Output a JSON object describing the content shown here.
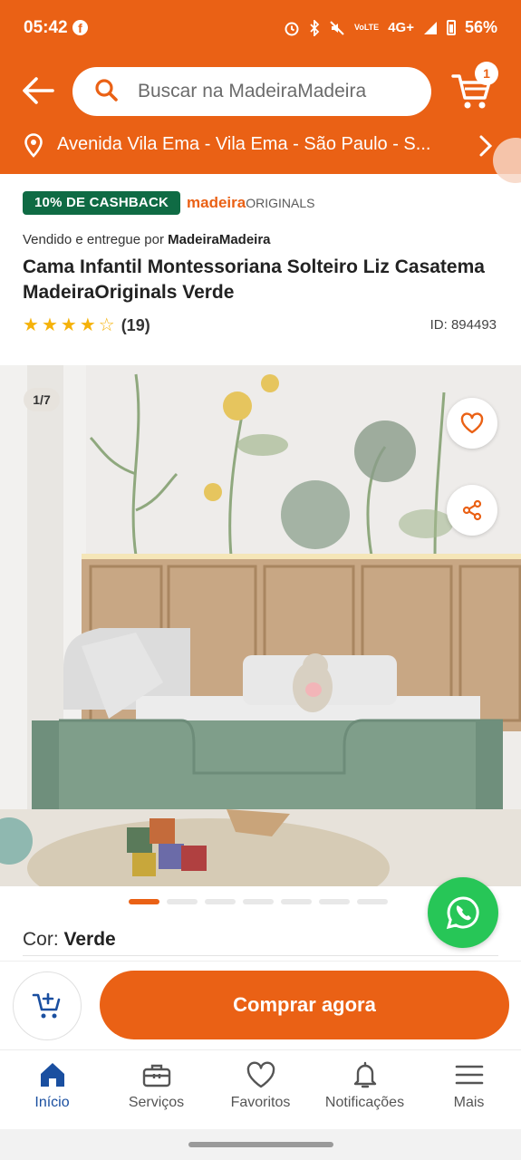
{
  "statusbar": {
    "time": "05:42",
    "app_badge": "f",
    "network_small": "VoLTE",
    "network": "4G+",
    "battery": "56%"
  },
  "header": {
    "search_placeholder": "Buscar na MadeiraMadeira",
    "cart_count": "1",
    "address": "Avenida Vila Ema - Vila Ema - São Paulo - S..."
  },
  "product": {
    "cashback": "10% DE CASHBACK",
    "brand_part1": "madeira",
    "brand_part2": "ORIGINALS",
    "seller_prefix": "Vendido e entregue por",
    "seller_name": "MadeiraMadeira",
    "title": "Cama Infantil Montessoriana Solteiro Liz Casatema MadeiraOriginals Verde",
    "rating": 4,
    "rating_max": 5,
    "rating_count": "(19)",
    "id": "ID: 894493",
    "image_counter": "1/7",
    "image_index": 1,
    "image_total": 7,
    "color_label": "Cor:",
    "color_value": "Verde"
  },
  "actions": {
    "buy_now": "Comprar agora"
  },
  "nav": {
    "items": [
      {
        "label": "Início",
        "icon": "home-icon",
        "active": true
      },
      {
        "label": "Serviços",
        "icon": "toolbox-icon",
        "active": false
      },
      {
        "label": "Favoritos",
        "icon": "heart-icon",
        "active": false
      },
      {
        "label": "Notificações",
        "icon": "bell-icon",
        "active": false
      },
      {
        "label": "Mais",
        "icon": "menu-icon",
        "active": false
      }
    ]
  },
  "colors": {
    "brand_orange": "#ea6115",
    "cashback_green": "#0f6b44",
    "nav_active_blue": "#1a4fa0",
    "whatsapp_green": "#27c657",
    "bed_green": "#7f9e8a"
  }
}
